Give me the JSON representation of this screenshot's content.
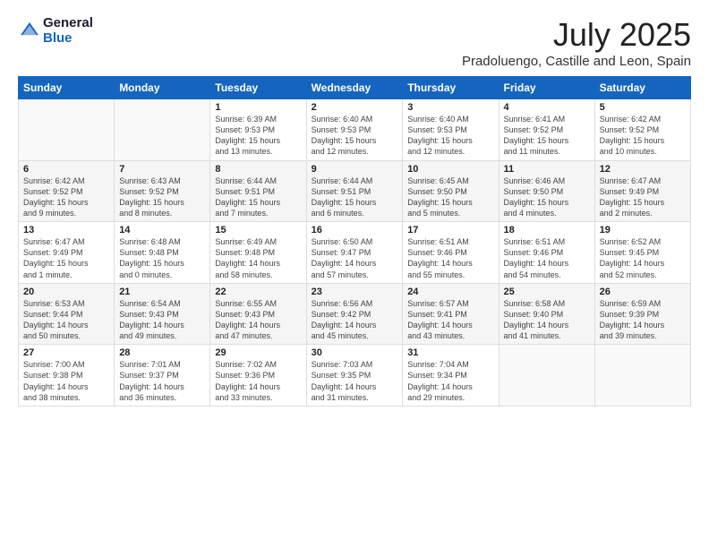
{
  "logo": {
    "line1": "General",
    "line2": "Blue"
  },
  "title": "July 2025",
  "subtitle": "Pradoluengo, Castille and Leon, Spain",
  "weekdays": [
    "Sunday",
    "Monday",
    "Tuesday",
    "Wednesday",
    "Thursday",
    "Friday",
    "Saturday"
  ],
  "weeks": [
    [
      {
        "day": "",
        "info": ""
      },
      {
        "day": "",
        "info": ""
      },
      {
        "day": "1",
        "info": "Sunrise: 6:39 AM\nSunset: 9:53 PM\nDaylight: 15 hours\nand 13 minutes."
      },
      {
        "day": "2",
        "info": "Sunrise: 6:40 AM\nSunset: 9:53 PM\nDaylight: 15 hours\nand 12 minutes."
      },
      {
        "day": "3",
        "info": "Sunrise: 6:40 AM\nSunset: 9:53 PM\nDaylight: 15 hours\nand 12 minutes."
      },
      {
        "day": "4",
        "info": "Sunrise: 6:41 AM\nSunset: 9:52 PM\nDaylight: 15 hours\nand 11 minutes."
      },
      {
        "day": "5",
        "info": "Sunrise: 6:42 AM\nSunset: 9:52 PM\nDaylight: 15 hours\nand 10 minutes."
      }
    ],
    [
      {
        "day": "6",
        "info": "Sunrise: 6:42 AM\nSunset: 9:52 PM\nDaylight: 15 hours\nand 9 minutes."
      },
      {
        "day": "7",
        "info": "Sunrise: 6:43 AM\nSunset: 9:52 PM\nDaylight: 15 hours\nand 8 minutes."
      },
      {
        "day": "8",
        "info": "Sunrise: 6:44 AM\nSunset: 9:51 PM\nDaylight: 15 hours\nand 7 minutes."
      },
      {
        "day": "9",
        "info": "Sunrise: 6:44 AM\nSunset: 9:51 PM\nDaylight: 15 hours\nand 6 minutes."
      },
      {
        "day": "10",
        "info": "Sunrise: 6:45 AM\nSunset: 9:50 PM\nDaylight: 15 hours\nand 5 minutes."
      },
      {
        "day": "11",
        "info": "Sunrise: 6:46 AM\nSunset: 9:50 PM\nDaylight: 15 hours\nand 4 minutes."
      },
      {
        "day": "12",
        "info": "Sunrise: 6:47 AM\nSunset: 9:49 PM\nDaylight: 15 hours\nand 2 minutes."
      }
    ],
    [
      {
        "day": "13",
        "info": "Sunrise: 6:47 AM\nSunset: 9:49 PM\nDaylight: 15 hours\nand 1 minute."
      },
      {
        "day": "14",
        "info": "Sunrise: 6:48 AM\nSunset: 9:48 PM\nDaylight: 15 hours\nand 0 minutes."
      },
      {
        "day": "15",
        "info": "Sunrise: 6:49 AM\nSunset: 9:48 PM\nDaylight: 14 hours\nand 58 minutes."
      },
      {
        "day": "16",
        "info": "Sunrise: 6:50 AM\nSunset: 9:47 PM\nDaylight: 14 hours\nand 57 minutes."
      },
      {
        "day": "17",
        "info": "Sunrise: 6:51 AM\nSunset: 9:46 PM\nDaylight: 14 hours\nand 55 minutes."
      },
      {
        "day": "18",
        "info": "Sunrise: 6:51 AM\nSunset: 9:46 PM\nDaylight: 14 hours\nand 54 minutes."
      },
      {
        "day": "19",
        "info": "Sunrise: 6:52 AM\nSunset: 9:45 PM\nDaylight: 14 hours\nand 52 minutes."
      }
    ],
    [
      {
        "day": "20",
        "info": "Sunrise: 6:53 AM\nSunset: 9:44 PM\nDaylight: 14 hours\nand 50 minutes."
      },
      {
        "day": "21",
        "info": "Sunrise: 6:54 AM\nSunset: 9:43 PM\nDaylight: 14 hours\nand 49 minutes."
      },
      {
        "day": "22",
        "info": "Sunrise: 6:55 AM\nSunset: 9:43 PM\nDaylight: 14 hours\nand 47 minutes."
      },
      {
        "day": "23",
        "info": "Sunrise: 6:56 AM\nSunset: 9:42 PM\nDaylight: 14 hours\nand 45 minutes."
      },
      {
        "day": "24",
        "info": "Sunrise: 6:57 AM\nSunset: 9:41 PM\nDaylight: 14 hours\nand 43 minutes."
      },
      {
        "day": "25",
        "info": "Sunrise: 6:58 AM\nSunset: 9:40 PM\nDaylight: 14 hours\nand 41 minutes."
      },
      {
        "day": "26",
        "info": "Sunrise: 6:59 AM\nSunset: 9:39 PM\nDaylight: 14 hours\nand 39 minutes."
      }
    ],
    [
      {
        "day": "27",
        "info": "Sunrise: 7:00 AM\nSunset: 9:38 PM\nDaylight: 14 hours\nand 38 minutes."
      },
      {
        "day": "28",
        "info": "Sunrise: 7:01 AM\nSunset: 9:37 PM\nDaylight: 14 hours\nand 36 minutes."
      },
      {
        "day": "29",
        "info": "Sunrise: 7:02 AM\nSunset: 9:36 PM\nDaylight: 14 hours\nand 33 minutes."
      },
      {
        "day": "30",
        "info": "Sunrise: 7:03 AM\nSunset: 9:35 PM\nDaylight: 14 hours\nand 31 minutes."
      },
      {
        "day": "31",
        "info": "Sunrise: 7:04 AM\nSunset: 9:34 PM\nDaylight: 14 hours\nand 29 minutes."
      },
      {
        "day": "",
        "info": ""
      },
      {
        "day": "",
        "info": ""
      }
    ]
  ]
}
